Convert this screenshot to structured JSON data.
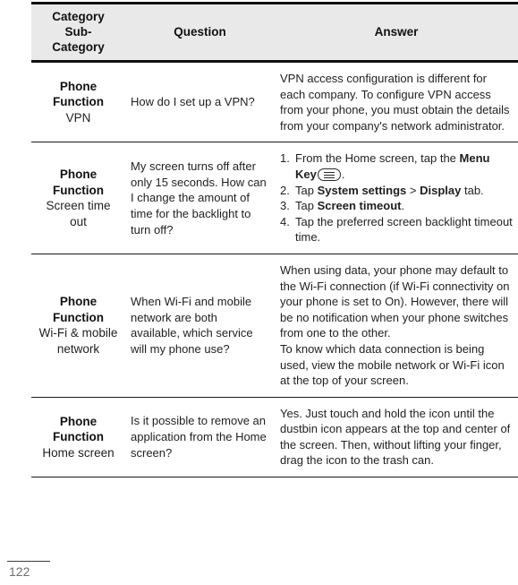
{
  "document": {
    "page_number": "122"
  },
  "table": {
    "headers": {
      "category": "Category",
      "sub": "Sub-",
      "category2": "Category",
      "question": "Question",
      "answer": "Answer"
    },
    "rows": [
      {
        "category": "Phone Function",
        "subcategory": "VPN",
        "question": "How do I set up a VPN?",
        "answer_paragraphs": [
          "VPN access configuration is different for each company. To configure VPN access from your phone, you must obtain the details from your company's network administrator."
        ]
      },
      {
        "category": "Phone Function",
        "subcategory": "Screen time out",
        "question": "My screen turns off after only 15 seconds. How can I change the amount of time for the backlight to turn off?",
        "answer_steps": [
          {
            "pre": "From the Home screen, tap the ",
            "bold1": "Menu Key",
            "icon": "menu-key-icon",
            "post": "."
          },
          {
            "pre": "Tap ",
            "bold1": "System settings",
            "mid": " > ",
            "bold2": "Display",
            "post": " tab."
          },
          {
            "pre": "Tap ",
            "bold1": "Screen timeout",
            "post": "."
          },
          {
            "pre": "Tap the preferred screen backlight timeout time.",
            "post": ""
          }
        ]
      },
      {
        "category": "Phone Function",
        "subcategory": "Wi-Fi & mobile network",
        "question": "When Wi-Fi and mobile network are both available, which service will my phone use?",
        "answer_paragraphs": [
          "When using data, your phone may default to the Wi-Fi connection (if Wi-Fi connectivity on your phone is set to On). However, there will be no notification when your phone switches from one to the other.",
          "To know which data connection is being used, view the mobile network or Wi-Fi icon at the top of your screen."
        ]
      },
      {
        "category": "Phone Function",
        "subcategory": "Home screen",
        "question": "Is it possible to remove an application from the Home screen?",
        "answer_paragraphs": [
          "Yes. Just touch and hold the icon until the dustbin icon appears at the top and center of the screen. Then, without lifting your finger, drag the icon to the trash can."
        ]
      }
    ]
  },
  "colors": {
    "header_background": "#e9e9e9",
    "border_strong": "#111111",
    "border_light": "#1a1a1a",
    "text": "#1f1f1f",
    "page_number": "#6e6e6e"
  }
}
